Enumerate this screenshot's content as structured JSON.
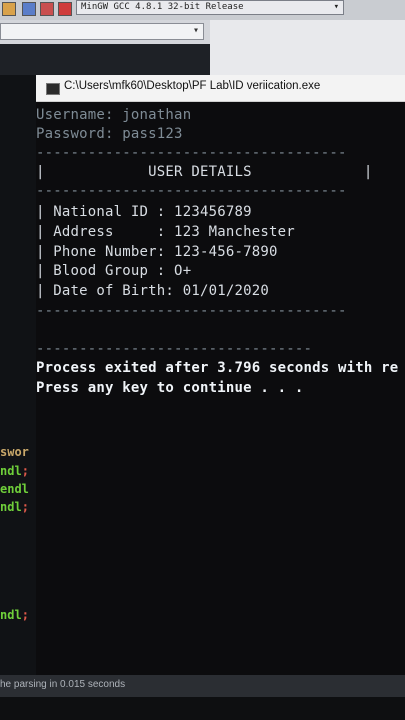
{
  "toolbar": {
    "compiler": "MinGW GCC 4.8.1 32-bit Release"
  },
  "editor": {
    "fragments": [
      "swor",
      "ndl",
      "endl",
      "ndl",
      "ndl"
    ],
    "semicolon": ";"
  },
  "console": {
    "title": "C:\\Users\\mfk60\\Desktop\\PF Lab\\ID veriication.exe",
    "lines": {
      "username": "Username: jonathan",
      "password": "Password: pass123",
      "rule1": "------------------------------------",
      "header": "|            USER DETAILS             |",
      "rule2": "------------------------------------",
      "national_id": "| National ID : 123456789",
      "address": "| Address     : 123 Manchester",
      "phone": "| Phone Number: 123-456-7890",
      "blood": "| Blood Group : O+",
      "dob": "| Date of Birth: 01/01/2020",
      "rule3": "------------------------------------",
      "rule4": "--------------------------------",
      "process": "Process exited after 3.796 seconds with re",
      "press": "Press any key to continue . . ."
    }
  },
  "status": {
    "text": "he parsing in 0.015 seconds"
  }
}
